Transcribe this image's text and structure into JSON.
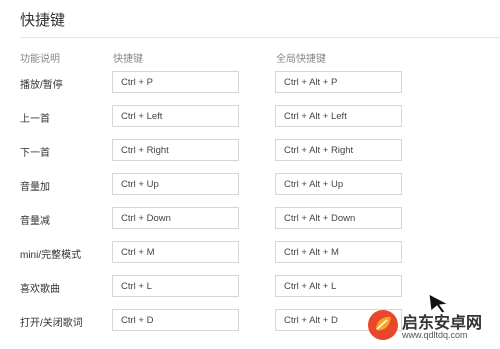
{
  "page": {
    "title": "快捷键",
    "headers": {
      "function": "功能说明",
      "local": "快捷键",
      "global": "全局快捷键"
    }
  },
  "rows": [
    {
      "label": "播放/暂停",
      "local": "Ctrl + P",
      "global": "Ctrl + Alt + P"
    },
    {
      "label": "上一首",
      "local": "Ctrl + Left",
      "global": "Ctrl + Alt + Left"
    },
    {
      "label": "下一首",
      "local": "Ctrl + Right",
      "global": "Ctrl + Alt + Right"
    },
    {
      "label": "音量加",
      "local": "Ctrl + Up",
      "global": "Ctrl + Alt + Up"
    },
    {
      "label": "音量减",
      "local": "Ctrl + Down",
      "global": "Ctrl + Alt + Down"
    },
    {
      "label": "mini/完整模式",
      "local": "Ctrl + M",
      "global": "Ctrl + Alt + M"
    },
    {
      "label": "喜欢歌曲",
      "local": "Ctrl + L",
      "global": "Ctrl + Alt + L"
    },
    {
      "label": "打开/关闭歌词",
      "local": "Ctrl + D",
      "global": "Ctrl + Alt + D"
    }
  ],
  "watermark": {
    "title": "启东安卓网",
    "url": "www.qdltdq.com",
    "colors": {
      "logo_outer": "#e8472b",
      "logo_inner": "#f6a623"
    }
  },
  "icons": {
    "cursor": "arrow-pointer-icon",
    "logo": "leaf-logo-icon"
  }
}
